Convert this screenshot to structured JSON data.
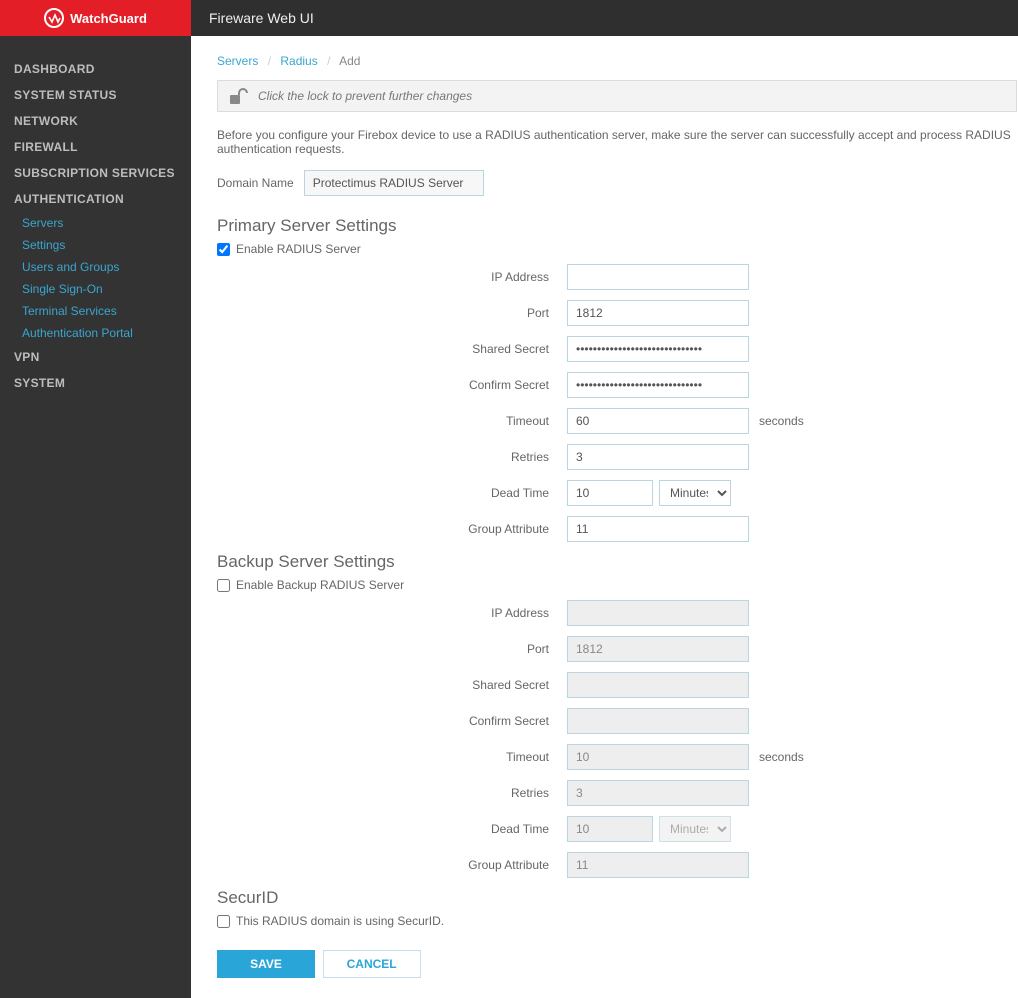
{
  "brand": "WatchGuard",
  "header_title": "Fireware Web UI",
  "sidebar": {
    "dashboard": "DASHBOARD",
    "system_status": "SYSTEM STATUS",
    "network": "NETWORK",
    "firewall": "FIREWALL",
    "subscription": "SUBSCRIPTION SERVICES",
    "authentication": "AUTHENTICATION",
    "auth_sub": {
      "servers": "Servers",
      "settings": "Settings",
      "users_groups": "Users and Groups",
      "sso": "Single Sign-On",
      "terminal": "Terminal Services",
      "auth_portal": "Authentication Portal"
    },
    "vpn": "VPN",
    "system": "SYSTEM"
  },
  "breadcrumb": {
    "a": "Servers",
    "b": "Radius",
    "c": "Add"
  },
  "lock_text": "Click the lock to prevent further changes",
  "intro_text": "Before you configure your Firebox device to use a RADIUS authentication server, make sure the server can successfully accept and process RADIUS authentication requests.",
  "domain_name_label": "Domain Name",
  "domain_name_value": "Protectimus RADIUS Server",
  "primary": {
    "title": "Primary Server Settings",
    "enable": "Enable RADIUS Server",
    "ip_label": "IP Address",
    "ip_value": "",
    "port_label": "Port",
    "port_value": "1812",
    "secret_label": "Shared Secret",
    "secret_value": "••••••••••••••••••••••••••••••",
    "confirm_label": "Confirm Secret",
    "confirm_value": "••••••••••••••••••••••••••••••",
    "timeout_label": "Timeout",
    "timeout_value": "60",
    "timeout_suffix": "seconds",
    "retries_label": "Retries",
    "retries_value": "3",
    "deadtime_label": "Dead Time",
    "deadtime_value": "10",
    "deadtime_unit": "Minutes",
    "group_label": "Group Attribute",
    "group_value": "11"
  },
  "backup": {
    "title": "Backup Server Settings",
    "enable": "Enable Backup RADIUS Server",
    "ip_label": "IP Address",
    "ip_value": "",
    "port_label": "Port",
    "port_value": "1812",
    "secret_label": "Shared Secret",
    "secret_value": "",
    "confirm_label": "Confirm Secret",
    "confirm_value": "",
    "timeout_label": "Timeout",
    "timeout_value": "10",
    "timeout_suffix": "seconds",
    "retries_label": "Retries",
    "retries_value": "3",
    "deadtime_label": "Dead Time",
    "deadtime_value": "10",
    "deadtime_unit": "Minutes",
    "group_label": "Group Attribute",
    "group_value": "11"
  },
  "securid": {
    "title": "SecurID",
    "label": "This RADIUS domain is using SecurID."
  },
  "buttons": {
    "save": "SAVE",
    "cancel": "CANCEL"
  }
}
